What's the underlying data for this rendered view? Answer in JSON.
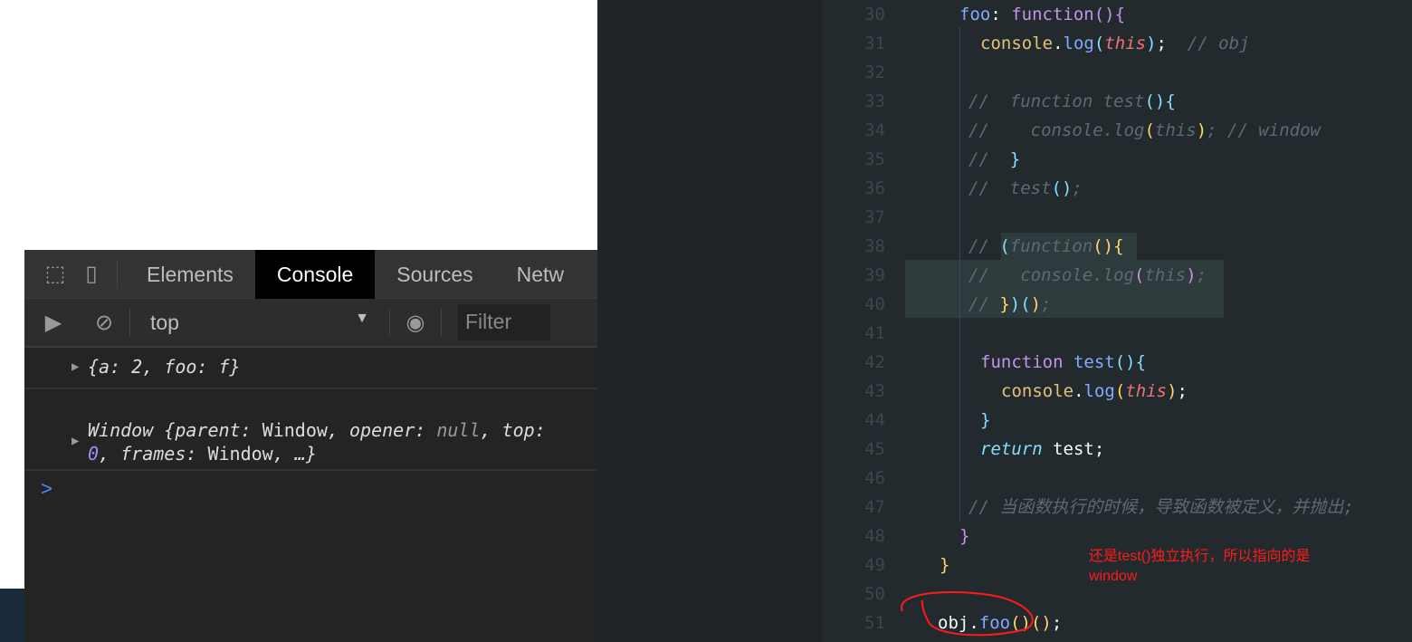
{
  "devtools": {
    "tabs": [
      "Elements",
      "Console",
      "Sources",
      "Netw"
    ],
    "active_tab": "Console",
    "context": "top",
    "filter_placeholder": "Filter",
    "messages": [
      {
        "text": "{a: 2, foo: f}"
      },
      {
        "text": "Window {parent: Window, opener: null, top: 0, frames: Window, …}"
      }
    ],
    "prompt": ">"
  },
  "editor": {
    "lines": [
      {
        "n": "30",
        "indent": 152,
        "tokens": [
          [
            "fn",
            "foo"
          ],
          [
            "plain",
            ": "
          ],
          [
            "kw",
            "function"
          ],
          [
            "pb",
            "(){"
          ]
        ]
      },
      {
        "n": "31",
        "indent": 175,
        "tokens": [
          [
            "obj",
            "console"
          ],
          [
            "plain",
            "."
          ],
          [
            "fn",
            "log"
          ],
          [
            "pn",
            "("
          ],
          [
            "this",
            "this"
          ],
          [
            "pn",
            ")"
          ],
          [
            "plain",
            ";  "
          ],
          [
            "cm",
            "// obj"
          ]
        ]
      },
      {
        "n": "32",
        "indent": 175,
        "tokens": []
      },
      {
        "n": "33",
        "indent": 162,
        "tokens": [
          [
            "cm",
            "//  function test"
          ],
          [
            "pn",
            "(){"
          ]
        ]
      },
      {
        "n": "34",
        "indent": 162,
        "tokens": [
          [
            "cm",
            "//    console.log"
          ],
          [
            "yb",
            "("
          ],
          [
            "cm",
            "this"
          ],
          [
            "yb",
            ")"
          ],
          [
            "cm",
            "; // window"
          ]
        ]
      },
      {
        "n": "35",
        "indent": 162,
        "tokens": [
          [
            "cm",
            "//  "
          ],
          [
            "pn",
            "}"
          ]
        ]
      },
      {
        "n": "36",
        "indent": 162,
        "tokens": [
          [
            "cm",
            "//  test"
          ],
          [
            "pn",
            "()"
          ],
          [
            "cm",
            ";"
          ]
        ]
      },
      {
        "n": "37",
        "indent": 162,
        "tokens": []
      },
      {
        "n": "38",
        "indent": 162,
        "tokens": [
          [
            "cm",
            "// "
          ],
          [
            "pn",
            "("
          ],
          [
            "cm",
            "function"
          ],
          [
            "yb",
            "(){"
          ]
        ]
      },
      {
        "n": "39",
        "indent": 162,
        "tokens": [
          [
            "cm",
            "//   console.log"
          ],
          [
            "pb",
            "("
          ],
          [
            "cm",
            "this"
          ],
          [
            "pb",
            ")"
          ],
          [
            "cm",
            ";"
          ]
        ]
      },
      {
        "n": "40",
        "indent": 162,
        "tokens": [
          [
            "cm",
            "// "
          ],
          [
            "yb",
            "}"
          ],
          [
            "pn",
            ")("
          ],
          [
            "yb",
            ")"
          ],
          [
            "cm",
            ";"
          ]
        ]
      },
      {
        "n": "41",
        "indent": 175,
        "tokens": []
      },
      {
        "n": "42",
        "indent": 175,
        "tokens": [
          [
            "kw",
            "function "
          ],
          [
            "fn",
            "test"
          ],
          [
            "pn",
            "(){"
          ]
        ]
      },
      {
        "n": "43",
        "indent": 198,
        "tokens": [
          [
            "obj",
            "console"
          ],
          [
            "plain",
            "."
          ],
          [
            "fn",
            "log"
          ],
          [
            "yb",
            "("
          ],
          [
            "this",
            "this"
          ],
          [
            "yb",
            ")"
          ],
          [
            "plain",
            ";"
          ]
        ]
      },
      {
        "n": "44",
        "indent": 175,
        "tokens": [
          [
            "pn",
            "}"
          ]
        ]
      },
      {
        "n": "45",
        "indent": 175,
        "tokens": [
          [
            "ret",
            "return"
          ],
          [
            "plain",
            " test;"
          ]
        ]
      },
      {
        "n": "46",
        "indent": 175,
        "tokens": []
      },
      {
        "n": "47",
        "indent": 162,
        "tokens": [
          [
            "cm",
            "// 当函数执行的时候，导致函数被定义，并抛出;"
          ]
        ]
      },
      {
        "n": "48",
        "indent": 152,
        "tokens": [
          [
            "pb",
            "}"
          ]
        ]
      },
      {
        "n": "49",
        "indent": 130,
        "tokens": [
          [
            "yb",
            "}"
          ]
        ]
      },
      {
        "n": "50",
        "indent": 130,
        "tokens": []
      },
      {
        "n": "51",
        "indent": 128,
        "tokens": [
          [
            "plain",
            "obj."
          ],
          [
            "fn",
            "foo"
          ],
          [
            "yb",
            "()"
          ],
          [
            "yb",
            "()"
          ],
          [
            "plain",
            ";"
          ]
        ]
      }
    ]
  },
  "annotation": {
    "text": "还是test()独立执行，所以指向的是window",
    "color": "#ff1a1a"
  }
}
